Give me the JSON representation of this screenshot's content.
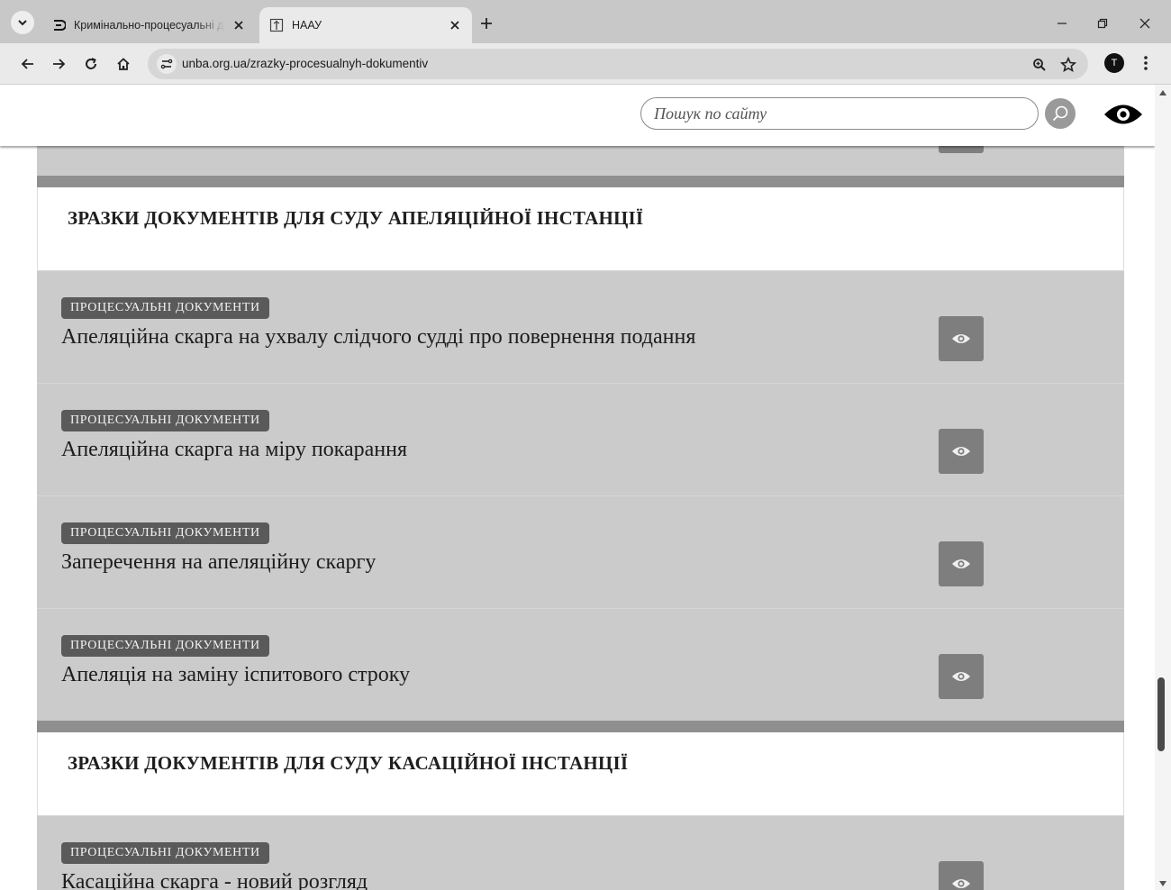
{
  "browser": {
    "tabs": [
      {
        "title": "Кримінально-процесуальні до",
        "active": false,
        "favicon": "document-favicon-icon"
      },
      {
        "title": "НААУ",
        "active": true,
        "favicon": "unba-favicon-icon"
      }
    ],
    "url": "unba.org.ua/zrazky-procesualnyh-dokumentiv",
    "profile_initial": "T"
  },
  "header": {
    "search_placeholder": "Пошук по сайту"
  },
  "sections": [
    {
      "title": "ЗРАЗКИ ДОКУМЕНТІВ ДЛЯ СУДУ АПЕЛЯЦІЙНОЇ ІНСТАНЦІЇ",
      "items": [
        {
          "tag": "ПРОЦЕСУАЛЬНІ ДОКУМЕНТИ",
          "title": "Апеляційна скарга на ухвалу слідчого судді про повернення подання"
        },
        {
          "tag": "ПРОЦЕСУАЛЬНІ ДОКУМЕНТИ",
          "title": "Апеляційна скарга на міру покарання"
        },
        {
          "tag": "ПРОЦЕСУАЛЬНІ ДОКУМЕНТИ",
          "title": "Заперечення на апеляційну скаргу"
        },
        {
          "tag": "ПРОЦЕСУАЛЬНІ ДОКУМЕНТИ",
          "title": "Апеляція на заміну іспитового строку"
        }
      ]
    },
    {
      "title": "ЗРАЗКИ ДОКУМЕНТІВ ДЛЯ СУДУ КАСАЦІЙНОЇ ІНСТАНЦІЇ",
      "items": [
        {
          "tag": "ПРОЦЕСУАЛЬНІ ДОКУМЕНТИ",
          "title": "Касаційна скарга - новий розгляд"
        }
      ]
    }
  ],
  "colors": {
    "row_background": "#cbcbcb",
    "divider": "#8f8f8f",
    "tag_background": "#5a5a5a",
    "view_button": "#7e7e7e"
  }
}
